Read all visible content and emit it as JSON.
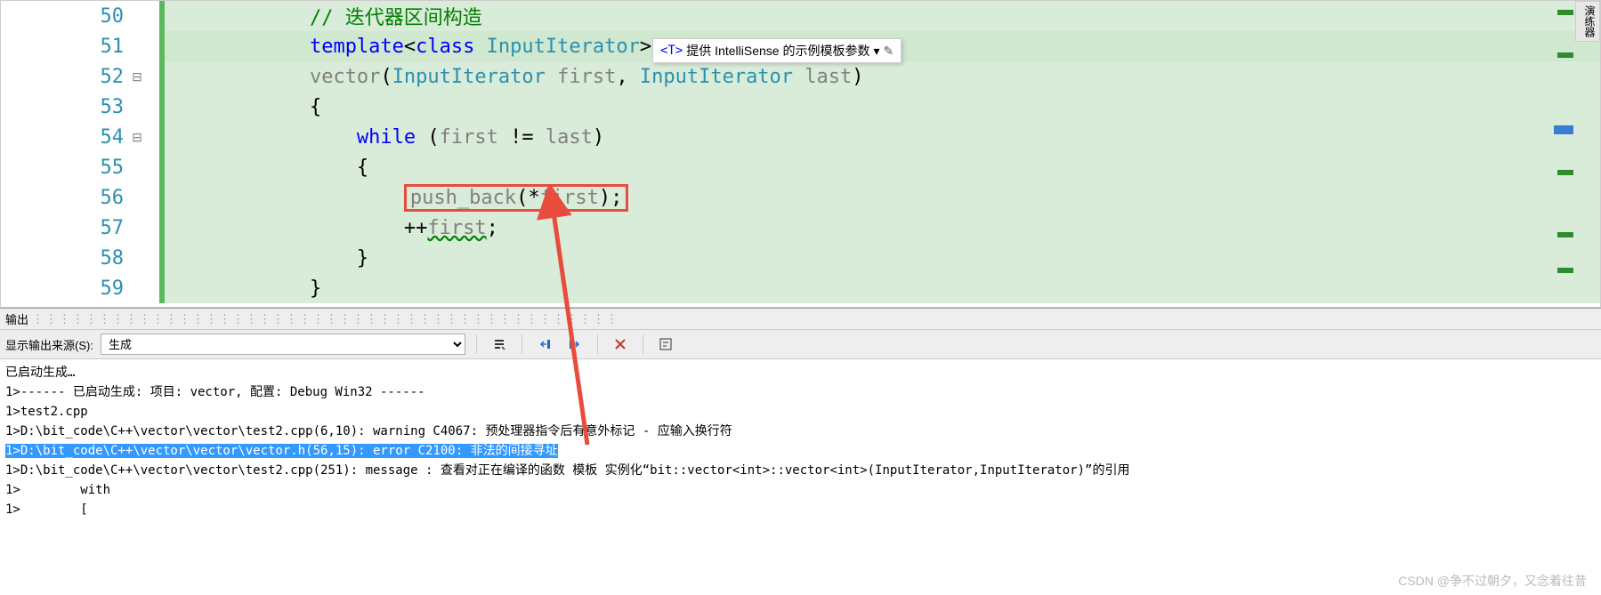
{
  "editor": {
    "lines": [
      {
        "num": "50",
        "fold": "",
        "changed": true,
        "current": false,
        "tokens": [
          [
            "            ",
            "punct"
          ],
          [
            "// 迭代器区间构造",
            "comment"
          ]
        ]
      },
      {
        "num": "51",
        "fold": "",
        "changed": true,
        "current": true,
        "tokens": [
          [
            "            ",
            "punct"
          ],
          [
            "template",
            "kw"
          ],
          [
            "<",
            "punct"
          ],
          [
            "class",
            "kw"
          ],
          [
            " ",
            "punct"
          ],
          [
            "InputIterator",
            "type"
          ],
          [
            ">",
            "punct"
          ]
        ]
      },
      {
        "num": "52",
        "fold": "⊟",
        "changed": true,
        "current": false,
        "tokens": [
          [
            "            ",
            "punct"
          ],
          [
            "vector",
            "ident"
          ],
          [
            "(",
            "punct"
          ],
          [
            "InputIterator",
            "type"
          ],
          [
            " ",
            "punct"
          ],
          [
            "first",
            "ident"
          ],
          [
            ", ",
            "punct"
          ],
          [
            "InputIterator",
            "type"
          ],
          [
            " ",
            "punct"
          ],
          [
            "last",
            "ident"
          ],
          [
            ")",
            "punct"
          ]
        ]
      },
      {
        "num": "53",
        "fold": "",
        "changed": true,
        "current": false,
        "tokens": [
          [
            "            {",
            "punct"
          ]
        ]
      },
      {
        "num": "54",
        "fold": "⊟",
        "changed": true,
        "current": false,
        "tokens": [
          [
            "                ",
            "punct"
          ],
          [
            "while",
            "kw"
          ],
          [
            " (",
            "punct"
          ],
          [
            "first",
            "ident"
          ],
          [
            " != ",
            "punct"
          ],
          [
            "last",
            "ident"
          ],
          [
            ")",
            "punct"
          ]
        ]
      },
      {
        "num": "55",
        "fold": "",
        "changed": true,
        "current": false,
        "tokens": [
          [
            "                {",
            "punct"
          ]
        ]
      },
      {
        "num": "56",
        "fold": "",
        "changed": true,
        "current": false,
        "boxed": true,
        "tokens": [
          [
            "                    ",
            "punct"
          ],
          [
            "push_back",
            "ident"
          ],
          [
            "(*",
            "punct"
          ],
          [
            "first",
            "ident"
          ],
          [
            ");",
            "punct"
          ]
        ]
      },
      {
        "num": "57",
        "fold": "",
        "changed": true,
        "current": false,
        "tokens": [
          [
            "                    ++",
            "punct"
          ],
          [
            "first",
            "ident-wavy"
          ],
          [
            ";",
            "punct"
          ]
        ]
      },
      {
        "num": "58",
        "fold": "",
        "changed": true,
        "current": false,
        "tokens": [
          [
            "                }",
            "punct"
          ]
        ]
      },
      {
        "num": "59",
        "fold": "",
        "changed": true,
        "current": false,
        "tokens": [
          [
            "            }",
            "punct"
          ]
        ]
      }
    ],
    "intellisense": {
      "tag": "<T>",
      "text": "提供 IntelliSense 的示例模板参数",
      "dropdown": "▾",
      "pencil": "✎"
    },
    "side_label": "演练器"
  },
  "output": {
    "panel_title": "输出",
    "source_label": "显示输出来源(S):",
    "source_selected": "生成",
    "lines": [
      {
        "text": "已启动生成…",
        "sel": false
      },
      {
        "text": "1>------ 已启动生成: 项目: vector, 配置: Debug Win32 ------",
        "sel": false
      },
      {
        "text": "1>test2.cpp",
        "sel": false
      },
      {
        "text": "1>D:\\bit_code\\C++\\vector\\vector\\test2.cpp(6,10): warning C4067: 预处理器指令后有意外标记 - 应输入换行符",
        "sel": false
      },
      {
        "text": "1>D:\\bit_code\\C++\\vector\\vector\\vector.h(56,15): error C2100: 非法的间接寻址",
        "sel": true
      },
      {
        "text": "1>D:\\bit_code\\C++\\vector\\vector\\test2.cpp(251): message : 查看对正在编译的函数 模板 实例化“bit::vector<int>::vector<int>(InputIterator,InputIterator)”的引用",
        "sel": false
      },
      {
        "text": "1>        with",
        "sel": false
      },
      {
        "text": "1>        [",
        "sel": false
      }
    ]
  },
  "watermark": "CSDN @争不过朝夕，又念着往昔"
}
